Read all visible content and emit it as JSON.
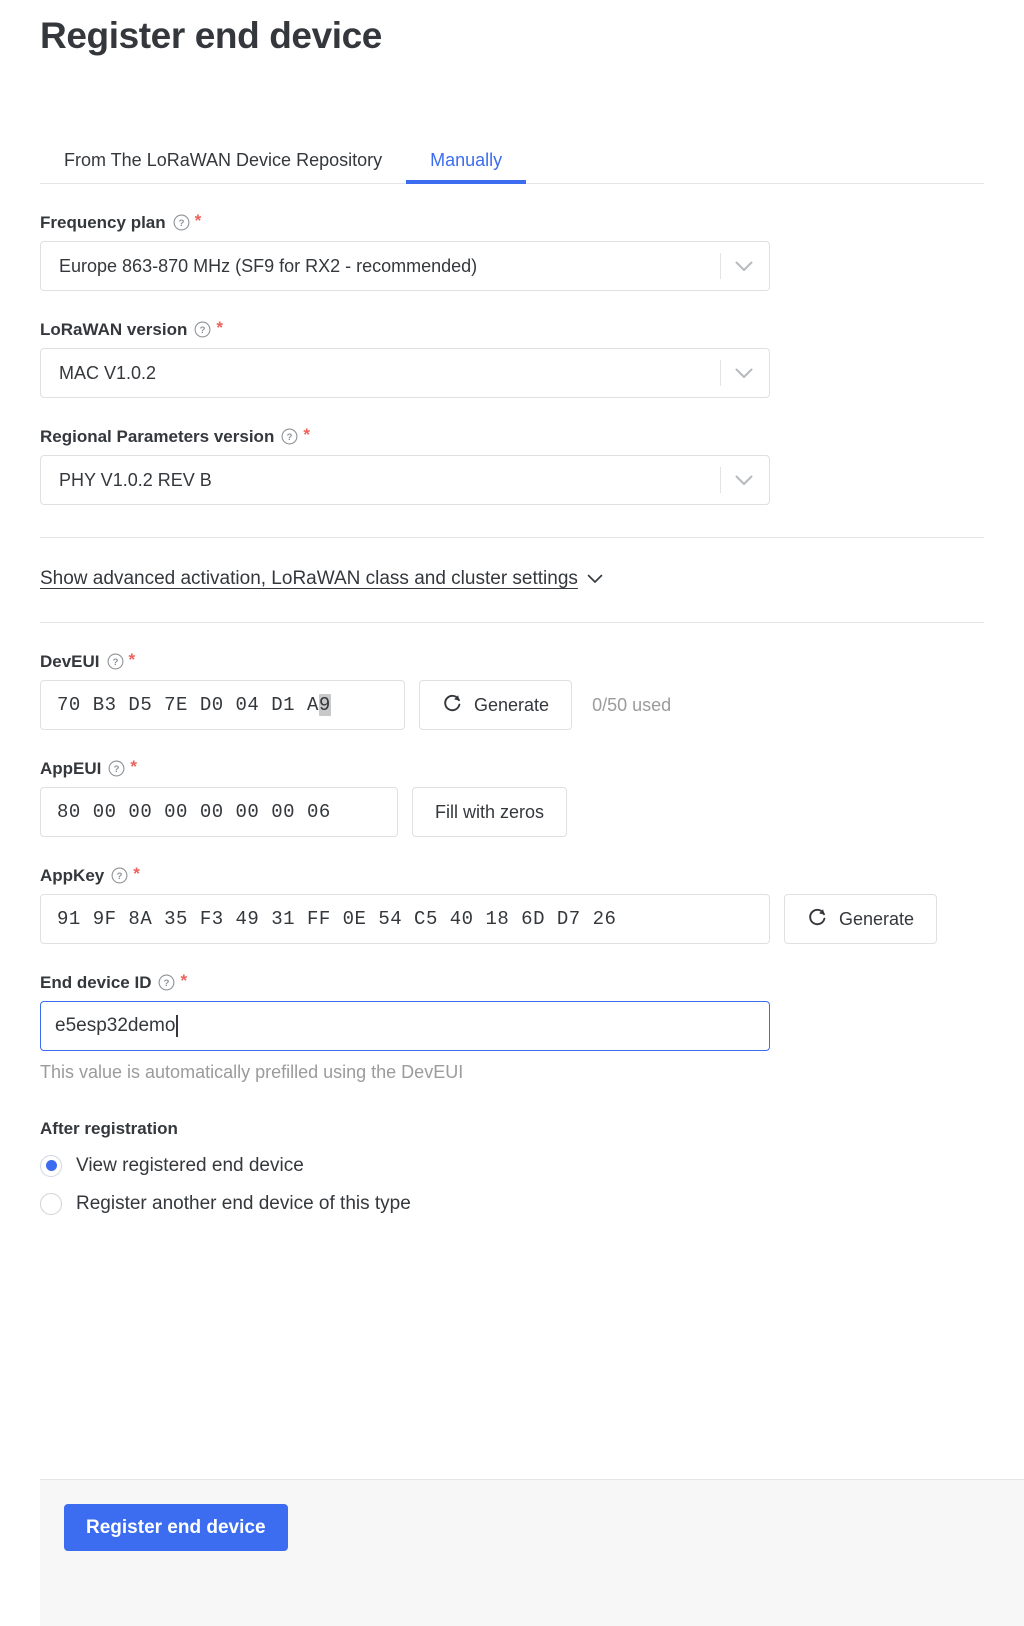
{
  "page": {
    "title": "Register end device"
  },
  "tabs": [
    {
      "label": "From The LoRaWAN Device Repository",
      "active": false
    },
    {
      "label": "Manually",
      "active": true
    }
  ],
  "fields": {
    "frequency_plan": {
      "label": "Frequency plan",
      "required_mark": "*",
      "value": "Europe 863-870 MHz (SF9 for RX2 - recommended)"
    },
    "lorawan_version": {
      "label": "LoRaWAN version",
      "required_mark": "*",
      "value": "MAC V1.0.2"
    },
    "regional_parameters_version": {
      "label": "Regional Parameters version",
      "required_mark": "*",
      "value": "PHY V1.0.2 REV B"
    },
    "deveui": {
      "label": "DevEUI",
      "required_mark": "*",
      "value": "70 B3 D5 7E D0 04 D1 A",
      "value_selected": "9",
      "generate_label": "Generate",
      "used_text": "0/50 used"
    },
    "appeui": {
      "label": "AppEUI",
      "required_mark": "*",
      "value": "80 00 00 00 00 00 00 06",
      "fill_label": "Fill with zeros"
    },
    "appkey": {
      "label": "AppKey",
      "required_mark": "*",
      "value": "91 9F 8A 35 F3 49 31 FF 0E 54 C5 40 18 6D D7 26",
      "generate_label": "Generate"
    },
    "end_device_id": {
      "label": "End device ID",
      "required_mark": "*",
      "value": "e5esp32demo",
      "hint": "This value is automatically prefilled using the DevEUI"
    }
  },
  "advanced_link": {
    "label": "Show advanced activation, LoRaWAN class and cluster settings"
  },
  "after_registration": {
    "label": "After registration",
    "options": [
      {
        "label": "View registered end device",
        "checked": true
      },
      {
        "label": "Register another end device of this type",
        "checked": false
      }
    ]
  },
  "footer": {
    "submit_label": "Register end device"
  },
  "colors": {
    "accent": "#3c6df0",
    "required": "#ec615b",
    "text": "#34383c",
    "muted": "#9b9b9b",
    "border": "#e0e0e0",
    "footer_bg": "#f7f7f7"
  }
}
